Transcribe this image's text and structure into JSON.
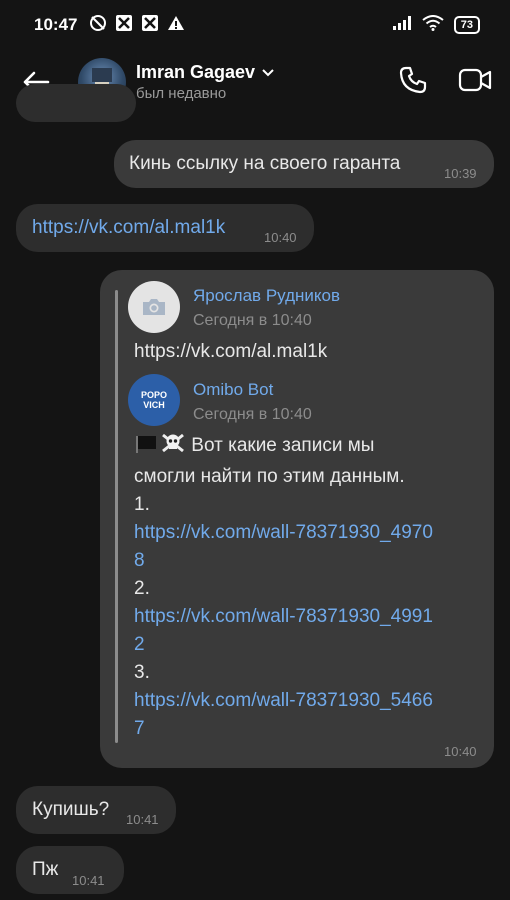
{
  "status": {
    "time": "10:47",
    "battery": "73"
  },
  "header": {
    "name": "Imran Gagaev",
    "status": "был недавно"
  },
  "messages": {
    "m1": {
      "text": "Кинь ссылку на своего гаранта",
      "time": "10:39"
    },
    "m2": {
      "text": "https://vk.com/al.mal1k",
      "time": "10:40"
    },
    "m3": {
      "time": "10:40",
      "fwd1": {
        "name": "Ярослав Рудников",
        "date": "Сегодня в 10:40",
        "text": "https://vk.com/al.mal1k"
      },
      "fwd2": {
        "name": "Omibo Bot",
        "date": "Сегодня в 10:40",
        "intro_line1": "Вот какие записи мы",
        "intro_line2": "смогли найти по этим данным.",
        "n1": "1.",
        "link1_a": "https://vk.com/wall-78371930_4970",
        "link1_b": "8",
        "n2": "2.",
        "link2_a": "https://vk.com/wall-78371930_4991",
        "link2_b": "2",
        "n3": "3.",
        "link3_a": "https://vk.com/wall-78371930_5466",
        "link3_b": "7",
        "bot_avatar_text": "POPOVICH"
      }
    },
    "m4": {
      "text": "Купишь?",
      "time": "10:41"
    },
    "m5": {
      "text": "Пж",
      "time": "10:41"
    }
  }
}
